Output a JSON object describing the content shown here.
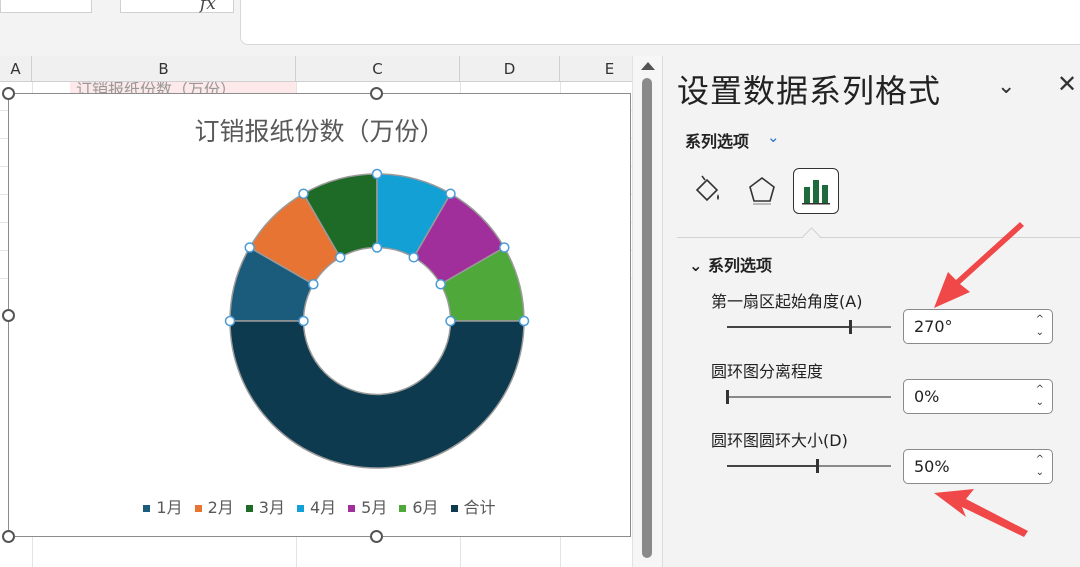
{
  "formula_bar": {
    "fx_symbol": "fx"
  },
  "sheet": {
    "columns": [
      "A",
      "B",
      "C",
      "D",
      "E"
    ],
    "cell_b1": "订销报纸份数（万份）"
  },
  "chart": {
    "title": "订销报纸份数（万份）",
    "legend": [
      {
        "label": "1月",
        "color": "#1b5c7d"
      },
      {
        "label": "2月",
        "color": "#e87434"
      },
      {
        "label": "3月",
        "color": "#1d6b26"
      },
      {
        "label": "4月",
        "color": "#13a0d5"
      },
      {
        "label": "5月",
        "color": "#a02e9b"
      },
      {
        "label": "6月",
        "color": "#4ea93a"
      },
      {
        "label": "合计",
        "color": "#0d3a4e"
      }
    ],
    "start_angle_deg": 270,
    "hole_size_percent": 50
  },
  "pane": {
    "title": "设置数据系列格式",
    "section_dropdown": "系列选项",
    "section_header": "系列选项",
    "options": [
      {
        "label": "第一扇区起始角度(A)",
        "value": "270°",
        "slider_fraction": 0.75
      },
      {
        "label": "圆环图分离程度",
        "value": "0%",
        "slider_fraction": 0.0
      },
      {
        "label": "圆环图圆环大小(D)",
        "value": "50%",
        "slider_fraction": 0.55
      }
    ],
    "accent_arrow_color": "#f04848"
  }
}
